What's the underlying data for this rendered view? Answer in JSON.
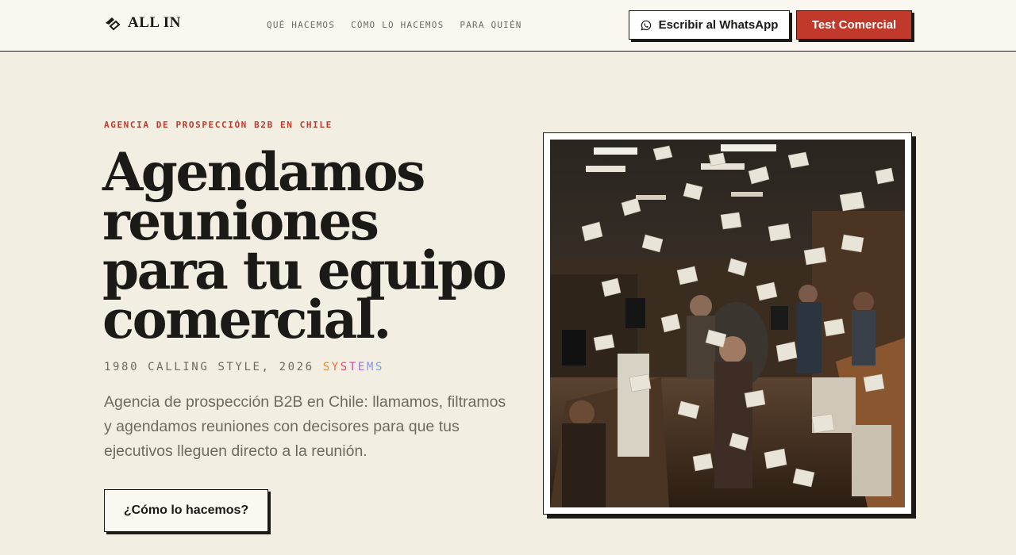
{
  "header": {
    "logo_text": "ALL IN",
    "nav": [
      "QUÉ HACEMOS",
      "CÓMO LO HACEMOS",
      "PARA QUIÉN"
    ],
    "whatsapp_button": "Escribir al WhatsApp",
    "test_button": "Test Comercial"
  },
  "hero": {
    "eyebrow": "AGENCIA DE PROSPECCIÓN B2B EN CHILE",
    "headline": [
      "Agendamos",
      "reuniones",
      "para tu equipo",
      "comercial."
    ],
    "tagline_prefix": "1980 CALLING STYLE, 2026 ",
    "tagline_highlight": "SYSTEMS",
    "description": "Agencia de prospección B2B en Chile: llamamos, filtramos y agendamos reuniones con decisores para que tus ejecutivos lleguen directo a la reunión.",
    "cta": "¿Cómo lo hacemos?"
  },
  "colors": {
    "background": "#f3eee2",
    "accent_red": "#c0392b",
    "ink": "#1c1a17",
    "muted": "#6f6a60"
  },
  "icons": {
    "logo": "diamond-arrow-icon",
    "whatsapp": "whatsapp-icon"
  }
}
